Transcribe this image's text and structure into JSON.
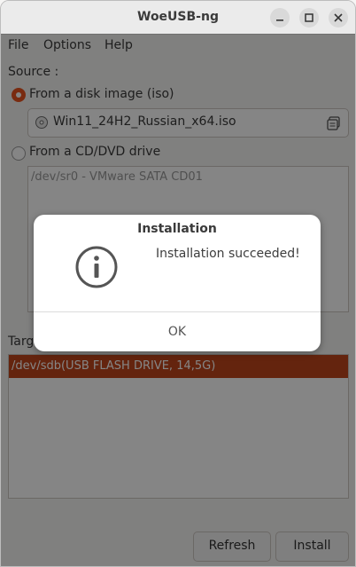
{
  "window": {
    "title": "WoeUSB-ng"
  },
  "menu": {
    "items": [
      "File",
      "Options",
      "Help"
    ]
  },
  "source": {
    "label": "Source :",
    "disk_image_label": "From a disk image (iso)",
    "iso_file": "Win11_24H2_Russian_x64.iso",
    "cd_label": "From a CD/DVD drive",
    "cd_devices": [
      "/dev/sr0 - VMware SATA CD01"
    ]
  },
  "target": {
    "label_visible": "Targ",
    "devices": [
      "/dev/sdb(USB FLASH DRIVE, 14,5G)"
    ]
  },
  "buttons": {
    "refresh": "Refresh",
    "install": "Install"
  },
  "dialog": {
    "title": "Installation",
    "message": "Installation succeeded!",
    "ok": "OK"
  },
  "colors": {
    "accent": "#e95420",
    "selection": "#c0461c"
  },
  "icons": [
    "minimize-icon",
    "maximize-icon",
    "close-icon",
    "disc-icon",
    "folder-browse-icon",
    "info-icon"
  ]
}
